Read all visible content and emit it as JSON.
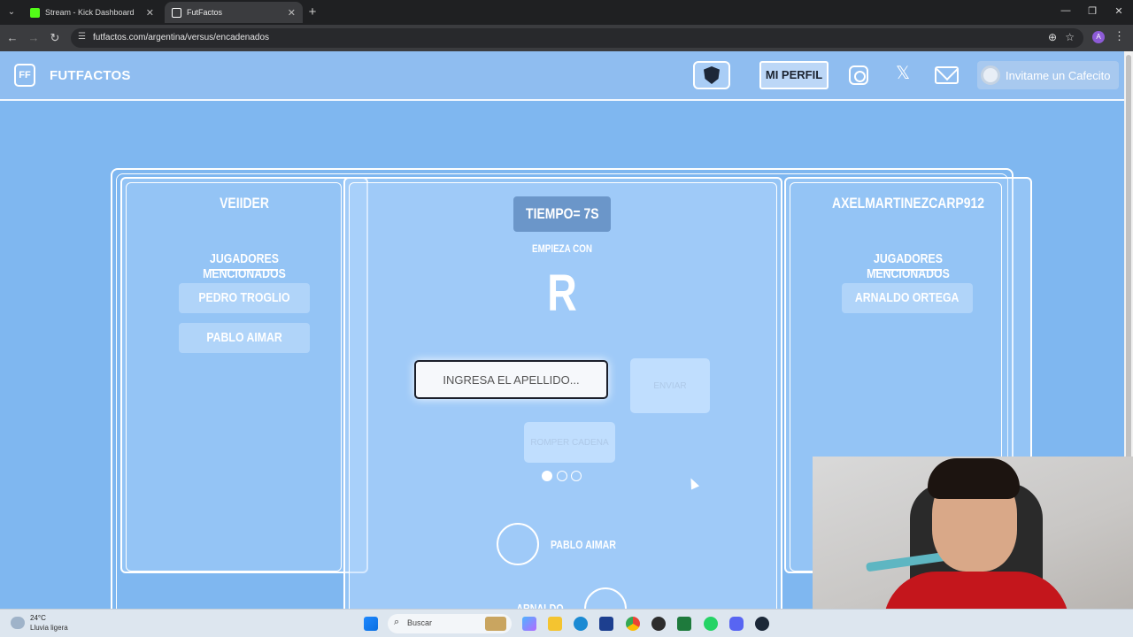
{
  "browser": {
    "tabs": [
      {
        "title": "Stream - Kick Dashboard",
        "favicon_color": "#53fc18",
        "active": false
      },
      {
        "title": "FutFactos",
        "favicon_color": "#ffffff",
        "active": true
      }
    ],
    "url": "futfactos.com/argentina/versus/encadenados",
    "profile_initial": "A"
  },
  "site": {
    "brand": "FUTFACTOS",
    "logo_text": "FF",
    "profile_label": "MI PERFIL",
    "coffee_label": "Invitame un Cafecito"
  },
  "game": {
    "left_player": {
      "name": "VEIIDER",
      "mentioned_title": "JUGADORES MENCIONADOS",
      "mentioned": [
        "PEDRO TROGLIO",
        "PABLO AIMAR"
      ]
    },
    "right_player": {
      "name": "AXELMARTINEZCARP912",
      "mentioned_title": "JUGADORES MENCIONADOS",
      "mentioned": [
        "ARNALDO ORTEGA"
      ]
    },
    "timer": "TIEMPO= 7S",
    "starts_with_label": "EMPIEZA CON",
    "starts_with_letter": "R",
    "input_placeholder": "INGRESA EL APELLIDO...",
    "send_label": "ENVIAR",
    "break_chain_label": "ROMPER CADENA",
    "lives": {
      "total": 3,
      "active": 1
    },
    "chain": [
      {
        "name": "PABLO AIMAR"
      },
      {
        "name": "ARNALDO ORTEGA"
      }
    ]
  },
  "taskbar": {
    "weather_temp": "24°C",
    "weather_desc": "Lluvia ligera",
    "search_label": "Buscar"
  },
  "colors": {
    "page_bg": "#7fb7f0",
    "accent": "#6b96c9"
  }
}
